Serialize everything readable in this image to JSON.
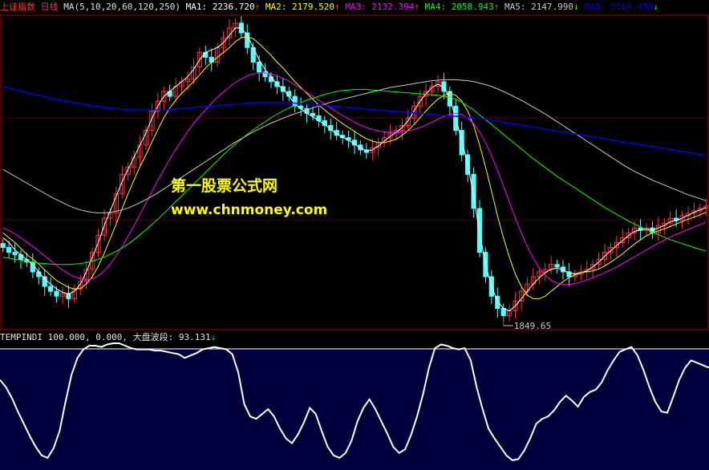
{
  "header": {
    "index_name": "上证指数",
    "period": "日线",
    "ma_params": "MA(5,10,20,60,120,250)",
    "ma_values": [
      {
        "label": "MA1",
        "value": "2236.720",
        "arrow": "↑",
        "color": "#ffffff"
      },
      {
        "label": "MA2",
        "value": "2179.520",
        "arrow": "↑",
        "color": "#ffff00"
      },
      {
        "label": "MA3",
        "value": "2132.394",
        "arrow": "↑",
        "color": "#ff00ff"
      },
      {
        "label": "MA4",
        "value": "2058.943",
        "arrow": "↑",
        "color": "#00ff00"
      },
      {
        "label": "MA5",
        "value": "2147.990",
        "arrow": "↓",
        "color": "#c8c8c8"
      },
      {
        "label": "MA6",
        "value": "2164.495",
        "arrow": "↓",
        "color": "#0000ff"
      }
    ]
  },
  "watermark": {
    "line1": "第一股票公式网",
    "line2": "www.chnmoney.com"
  },
  "low_marker": "1849.65",
  "indicator": {
    "name": "TEMPINDI",
    "param1": "100.000",
    "param2": "0.000",
    "wave_label": "大盘波段",
    "wave_value": "93.131",
    "wave_arrow": "↓"
  },
  "colors": {
    "up": "#ff3232",
    "down": "#54ffff",
    "ma1": "#ffffff",
    "ma2": "#ffff00",
    "ma3": "#ff00ff",
    "ma4": "#00ff00",
    "ma5": "#c8c8c8",
    "ma6": "#0000ff",
    "frame": "#b00000",
    "indicator_bg": "#00003c",
    "indicator_line": "#ffffff"
  },
  "chart_data": [
    {
      "type": "candlestick",
      "title": "上证指数 日线",
      "ylim": [
        1849.65,
        2478
      ],
      "approx_index_at_x": "day index (0-118)",
      "closes": [
        2010,
        2000,
        1995,
        1985,
        1980,
        1960,
        1950,
        1930,
        1920,
        1910,
        1915,
        1905,
        1925,
        1940,
        1965,
        2000,
        2035,
        2070,
        2080,
        2120,
        2160,
        2175,
        2195,
        2220,
        2250,
        2290,
        2310,
        2330,
        2320,
        2340,
        2350,
        2355,
        2380,
        2410,
        2400,
        2390,
        2420,
        2440,
        2460,
        2470,
        2450,
        2420,
        2390,
        2370,
        2360,
        2350,
        2340,
        2330,
        2320,
        2300,
        2295,
        2285,
        2280,
        2270,
        2260,
        2250,
        2240,
        2235,
        2230,
        2220,
        2210,
        2205,
        2215,
        2225,
        2235,
        2245,
        2250,
        2260,
        2275,
        2300,
        2320,
        2330,
        2340,
        2350,
        2330,
        2300,
        2250,
        2200,
        2160,
        2090,
        2000,
        1950,
        1910,
        1885,
        1870,
        1880,
        1900,
        1920,
        1935,
        1950,
        1960,
        1965,
        1975,
        1970,
        1960,
        1950,
        1955,
        1960,
        1965,
        1975,
        1985,
        2000,
        2010,
        2020,
        2030,
        2040,
        2050,
        2045,
        2050,
        2040,
        2055,
        2060,
        2070,
        2065,
        2075,
        2080,
        2085,
        2090,
        2095
      ],
      "series": [
        {
          "name": "MA1",
          "values": [
            2030,
            2020,
            2005,
            1995,
            1985,
            1975,
            1960,
            1945,
            1935,
            1925,
            1918,
            1915,
            1920,
            1935,
            1960,
            1990,
            2020,
            2055,
            2085,
            2115,
            2145,
            2170,
            2195,
            2220,
            2245,
            2275,
            2300,
            2320,
            2330,
            2340,
            2350,
            2360,
            2375,
            2395,
            2410,
            2415,
            2420,
            2430,
            2445,
            2460,
            2460,
            2445,
            2420,
            2395,
            2375,
            2360,
            2345,
            2335,
            2320,
            2305,
            2295,
            2285,
            2278,
            2270,
            2262,
            2252,
            2243,
            2236,
            2230,
            2222,
            2214,
            2208,
            2210,
            2218,
            2228,
            2238,
            2246,
            2256,
            2270,
            2290,
            2310,
            2325,
            2338,
            2345,
            2338,
            2315,
            2275,
            2230,
            2180,
            2115,
            2040,
            1975,
            1930,
            1900,
            1885,
            1880,
            1890,
            1905,
            1920,
            1935,
            1948,
            1958,
            1965,
            1968,
            1964,
            1958,
            1956,
            1958,
            1962,
            1970,
            1980,
            1992,
            2003,
            2014,
            2024,
            2034,
            2043,
            2046,
            2048,
            2045,
            2050,
            2055,
            2063,
            2065,
            2070,
            2076,
            2082,
            2087,
            2092
          ]
        },
        {
          "name": "MA2",
          "values": [
            2040,
            2030,
            2020,
            2008,
            1996,
            1986,
            1976,
            1964,
            1953,
            1942,
            1935,
            1928,
            1925,
            1926,
            1935,
            1950,
            1972,
            1998,
            2028,
            2058,
            2090,
            2120,
            2148,
            2176,
            2200,
            2226,
            2252,
            2276,
            2296,
            2312,
            2326,
            2338,
            2350,
            2364,
            2378,
            2390,
            2400,
            2410,
            2420,
            2432,
            2440,
            2442,
            2438,
            2428,
            2416,
            2404,
            2390,
            2378,
            2364,
            2350,
            2338,
            2326,
            2314,
            2302,
            2292,
            2282,
            2273,
            2264,
            2256,
            2248,
            2240,
            2233,
            2228,
            2225,
            2225,
            2228,
            2232,
            2240,
            2250,
            2262,
            2276,
            2290,
            2303,
            2314,
            2322,
            2326,
            2322,
            2310,
            2290,
            2260,
            2220,
            2175,
            2125,
            2075,
            2030,
            1990,
            1955,
            1930,
            1912,
            1905,
            1905,
            1910,
            1920,
            1930,
            1940,
            1948,
            1954,
            1958,
            1960,
            1962,
            1966,
            1972,
            1980,
            1988,
            1997,
            2007,
            2017,
            2026,
            2034,
            2040,
            2044,
            2048,
            2053,
            2058,
            2063,
            2068,
            2072,
            2077,
            2082
          ]
        },
        {
          "name": "MA3",
          "values": [
            2050,
            2045,
            2038,
            2030,
            2021,
            2012,
            2003,
            1993,
            1983,
            1973,
            1964,
            1956,
            1950,
            1946,
            1944,
            1946,
            1952,
            1962,
            1976,
            1993,
            2012,
            2033,
            2055,
            2078,
            2101,
            2125,
            2148,
            2170,
            2191,
            2211,
            2230,
            2248,
            2264,
            2279,
            2293,
            2306,
            2318,
            2329,
            2339,
            2348,
            2356,
            2362,
            2366,
            2368,
            2368,
            2366,
            2362,
            2357,
            2351,
            2344,
            2336,
            2328,
            2320,
            2312,
            2304,
            2296,
            2288,
            2281,
            2274,
            2267,
            2261,
            2256,
            2252,
            2249,
            2247,
            2246,
            2246,
            2247,
            2249,
            2252,
            2256,
            2261,
            2267,
            2273,
            2279,
            2283,
            2285,
            2283,
            2276,
            2264,
            2247,
            2225,
            2198,
            2168,
            2136,
            2103,
            2070,
            2040,
            2012,
            1988,
            1968,
            1953,
            1943,
            1937,
            1934,
            1934,
            1936,
            1939,
            1943,
            1948,
            1953,
            1958,
            1964,
            1970,
            1977,
            1984,
            1991,
            1998,
            2005,
            2012,
            2019,
            2025,
            2031,
            2037,
            2042,
            2047,
            2052,
            2057,
            2062
          ]
        },
        {
          "name": "MA4",
          "values": [
            1990,
            1988,
            1986,
            1984,
            1982,
            1980,
            1978,
            1977,
            1976,
            1975,
            1975,
            1975,
            1976,
            1977,
            1979,
            1982,
            1986,
            1990,
            1996,
            2002,
            2009,
            2017,
            2026,
            2036,
            2046,
            2057,
            2068,
            2080,
            2092,
            2104,
            2116,
            2128,
            2140,
            2152,
            2164,
            2176,
            2188,
            2200,
            2211,
            2222,
            2232,
            2242,
            2251,
            2260,
            2268,
            2276,
            2283,
            2290,
            2296,
            2302,
            2307,
            2312,
            2316,
            2320,
            2324,
            2327,
            2330,
            2332,
            2333,
            2334,
            2334,
            2334,
            2333,
            2332,
            2331,
            2330,
            2329,
            2328,
            2327,
            2326,
            2325,
            2324,
            2323,
            2322,
            2320,
            2318,
            2314,
            2308,
            2300,
            2292,
            2282,
            2272,
            2262,
            2252,
            2242,
            2232,
            2222,
            2212,
            2202,
            2192,
            2183,
            2174,
            2165,
            2156,
            2148,
            2140,
            2132,
            2124,
            2116,
            2108,
            2100,
            2092,
            2085,
            2078,
            2071,
            2064,
            2058,
            2052,
            2046,
            2041,
            2036,
            2031,
            2026,
            2022,
            2018,
            2014,
            2010,
            2006,
            2003
          ]
        },
        {
          "name": "MA5",
          "values": [
            2170,
            2163,
            2156,
            2149,
            2142,
            2135,
            2128,
            2121,
            2114,
            2108,
            2102,
            2096,
            2091,
            2087,
            2084,
            2082,
            2081,
            2081,
            2082,
            2084,
            2087,
            2091,
            2096,
            2102,
            2108,
            2115,
            2122,
            2130,
            2138,
            2146,
            2154,
            2162,
            2170,
            2178,
            2186,
            2194,
            2202,
            2210,
            2218,
            2226,
            2233,
            2240,
            2247,
            2253,
            2259,
            2265,
            2270,
            2275,
            2280,
            2284,
            2288,
            2292,
            2296,
            2300,
            2304,
            2308,
            2311,
            2314,
            2317,
            2320,
            2323,
            2326,
            2329,
            2332,
            2335,
            2338,
            2340,
            2342,
            2344,
            2346,
            2348,
            2350,
            2352,
            2353,
            2354,
            2354,
            2354,
            2353,
            2352,
            2350,
            2347,
            2344,
            2340,
            2335,
            2330,
            2324,
            2318,
            2312,
            2305,
            2298,
            2291,
            2284,
            2276,
            2268,
            2260,
            2252,
            2244,
            2236,
            2228,
            2220,
            2212,
            2204,
            2196,
            2188,
            2180,
            2173,
            2166,
            2160,
            2154,
            2148,
            2143,
            2138,
            2133,
            2128,
            2123,
            2118,
            2114,
            2110,
            2106
          ]
        },
        {
          "name": "MA6",
          "values": [
            2340,
            2337,
            2334,
            2331,
            2328,
            2325,
            2322,
            2319,
            2316,
            2313,
            2311,
            2309,
            2307,
            2305,
            2303,
            2301,
            2299,
            2297,
            2296,
            2295,
            2294,
            2293,
            2292,
            2292,
            2292,
            2292,
            2292,
            2292,
            2293,
            2294,
            2295,
            2296,
            2297,
            2298,
            2299,
            2300,
            2301,
            2302,
            2303,
            2304,
            2305,
            2306,
            2307,
            2307,
            2307,
            2307,
            2307,
            2307,
            2307,
            2306,
            2305,
            2304,
            2303,
            2302,
            2301,
            2300,
            2299,
            2298,
            2297,
            2296,
            2295,
            2294,
            2293,
            2292,
            2291,
            2290,
            2289,
            2288,
            2287,
            2286,
            2285,
            2284,
            2283,
            2282,
            2281,
            2280,
            2279,
            2278,
            2277,
            2276,
            2275,
            2273,
            2271,
            2269,
            2267,
            2265,
            2263,
            2261,
            2259,
            2257,
            2255,
            2253,
            2251,
            2249,
            2247,
            2245,
            2243,
            2241,
            2239,
            2237,
            2235,
            2233,
            2231,
            2229,
            2227,
            2225,
            2223,
            2221,
            2219,
            2217,
            2215,
            2213,
            2211,
            2209,
            2207,
            2205,
            2203,
            2201,
            2199
          ]
        }
      ]
    },
    {
      "type": "line",
      "title": "TEMPINDI",
      "ylim": [
        0,
        100
      ],
      "series": [
        {
          "name": "大盘波段",
          "values": [
            70,
            64,
            55,
            44,
            34,
            24,
            15,
            8,
            6,
            14,
            28,
            52,
            74,
            88,
            95,
            98,
            98,
            97,
            99,
            100,
            100,
            98,
            96,
            95,
            95,
            95,
            94,
            94,
            93,
            92,
            91,
            88,
            90,
            92,
            95,
            96,
            97,
            96,
            95,
            91,
            76,
            50,
            40,
            38,
            42,
            46,
            40,
            30,
            22,
            18,
            25,
            35,
            47,
            42,
            28,
            15,
            8,
            6,
            10,
            20,
            36,
            47,
            54,
            46,
            36,
            26,
            15,
            10,
            13,
            25,
            40,
            58,
            80,
            96,
            99,
            98,
            96,
            95,
            96,
            86,
            64,
            46,
            30,
            22,
            15,
            8,
            4,
            5,
            12,
            22,
            34,
            38,
            40,
            45,
            52,
            57,
            53,
            48,
            56,
            60,
            62,
            68,
            78,
            86,
            93,
            95,
            97,
            90,
            78,
            64,
            52,
            44,
            43,
            56,
            70,
            80,
            86,
            84,
            82,
            80
          ]
        }
      ]
    }
  ]
}
